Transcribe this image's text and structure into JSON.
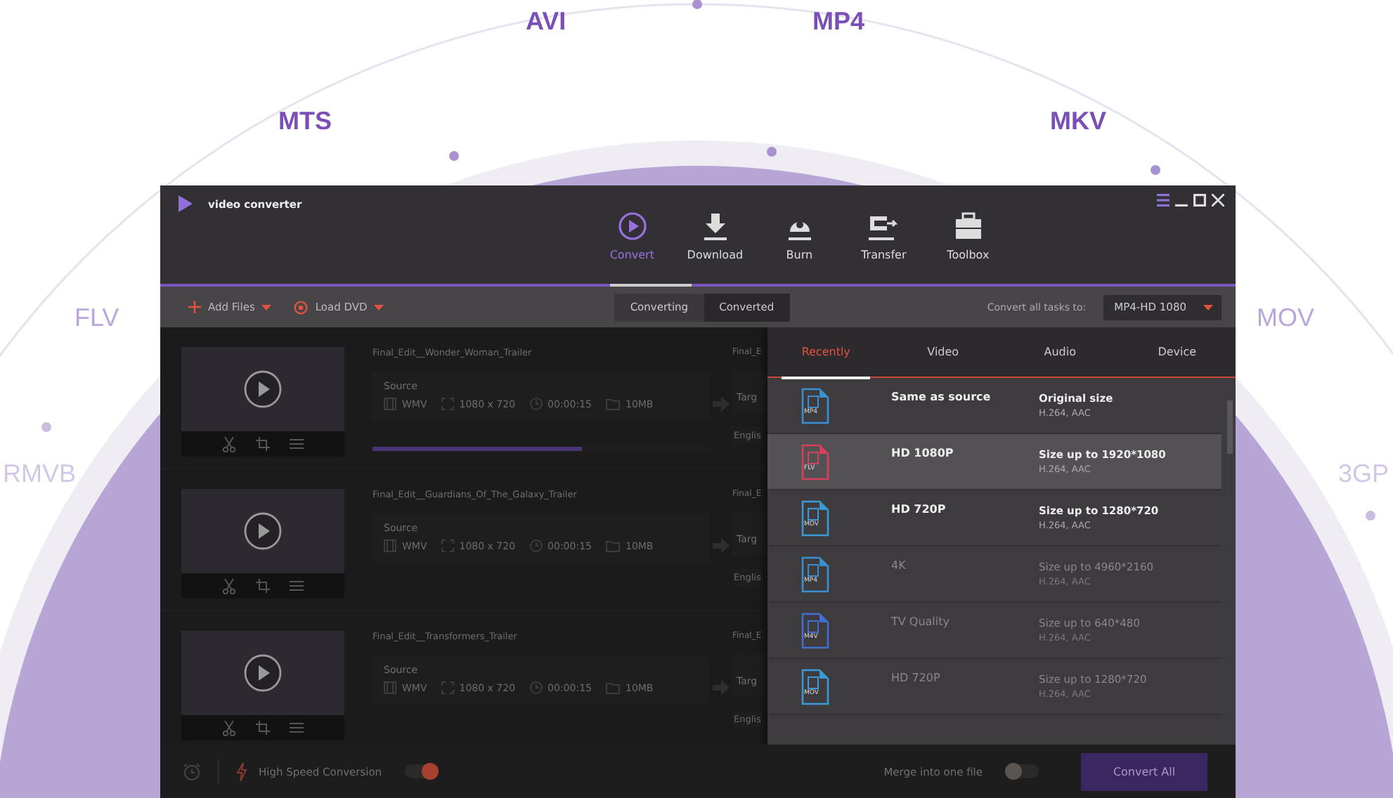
{
  "formats_ring": [
    {
      "label": "AVI"
    },
    {
      "label": "MP4"
    },
    {
      "label": "MTS"
    },
    {
      "label": "MKV"
    },
    {
      "label": "FLV"
    },
    {
      "label": "MOV"
    },
    {
      "label": "RMVB"
    },
    {
      "label": "3GP"
    }
  ],
  "window": {
    "title": "video converter"
  },
  "nav": [
    {
      "label": "Convert",
      "selected": true
    },
    {
      "label": "Download",
      "selected": false
    },
    {
      "label": "Burn",
      "selected": false
    },
    {
      "label": "Transfer",
      "selected": false
    },
    {
      "label": "Toolbox",
      "selected": false
    }
  ],
  "toolbar": {
    "add_files": "Add Files",
    "load_dvd": "Load DVD",
    "segments": [
      {
        "label": "Converting",
        "selected": false
      },
      {
        "label": "Converted",
        "selected": true
      }
    ],
    "convert_all_label": "Convert all tasks to:",
    "convert_all_value": "MP4-HD 1080"
  },
  "files": [
    {
      "title": "Final_Edit__Wonder_Woman_Trailer",
      "source_label": "Source",
      "format": "WMV",
      "resolution": "1080 x 720",
      "duration": "00:00:15",
      "size": "10MB",
      "progress": {
        "level": 0.62
      },
      "target_title": "Final_E",
      "target_label": "Targ",
      "subtitle": "Englis"
    },
    {
      "title": "Final_Edit__Guardians_Of_The_Galaxy_Trailer",
      "source_label": "Source",
      "format": "WMV",
      "resolution": "1080 x 720",
      "duration": "00:00:15",
      "size": "10MB",
      "target_title": "Final_E",
      "target_label": "Targ",
      "subtitle": "Englis"
    },
    {
      "title": "Final_Edit__Transformers_Trailer",
      "source_label": "Source",
      "format": "WMV",
      "resolution": "1080 x 720",
      "duration": "00:00:15",
      "size": "10MB",
      "target_title": "Final_E",
      "target_label": "Targ",
      "subtitle": "Englis"
    }
  ],
  "format_menu": {
    "tabs": [
      {
        "label": "Recently",
        "selected": true
      },
      {
        "label": "Video",
        "selected": false
      },
      {
        "label": "Audio",
        "selected": false
      },
      {
        "label": "Device",
        "selected": false
      }
    ],
    "items": [
      {
        "ext": "MP4",
        "color": "#3a8fd0",
        "name": "Same as source",
        "size": "Original size",
        "codec": "H.264, AAC",
        "selected": false,
        "dimmed": false
      },
      {
        "ext": "FLV",
        "color": "#d6405a",
        "name": "HD 1080P",
        "size": "Size up to 1920*1080",
        "codec": "H.264, AAC",
        "selected": true,
        "dimmed": false
      },
      {
        "ext": "MOV",
        "color": "#3a9ad6",
        "name": "HD 720P",
        "size": "Size up to 1280*720",
        "codec": "H.264, AAC",
        "selected": false,
        "dimmed": false
      },
      {
        "ext": "MP4",
        "color": "#3a8fd0",
        "name": "4K",
        "size": "Size up to 4960*2160",
        "codec": "H.264, AAC",
        "selected": false,
        "dimmed": true
      },
      {
        "ext": "M4V",
        "color": "#3f6fd0",
        "name": "TV Quality",
        "size": "Size up to 640*480",
        "codec": "H.264, AAC",
        "selected": false,
        "dimmed": true
      },
      {
        "ext": "MOV",
        "color": "#3a9ad6",
        "name": "HD 720P",
        "size": "Size up to 1280*720",
        "codec": "H.264, AAC",
        "selected": false,
        "dimmed": true
      }
    ]
  },
  "bottom_bar": {
    "high_speed": {
      "label": "High Speed Conversion",
      "on": true
    },
    "merge": {
      "label": "Merge into one file",
      "on": false
    },
    "convert_all": "Convert All"
  }
}
